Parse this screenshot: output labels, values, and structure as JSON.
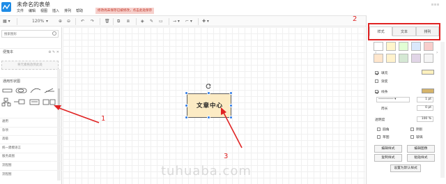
{
  "window": {
    "title": "未命名的表单",
    "menu": [
      "文件",
      "编辑",
      "视图",
      "插入",
      "排列",
      "帮助"
    ],
    "save_warning": "修改尚未保存已被修改，点击此处保存"
  },
  "toolbar": {
    "zoom": "120%"
  },
  "left_panel": {
    "search_placeholder": "搜索图形",
    "scratchpad_title": "便笺本",
    "scratchpad_drop": "将元素拖放到此处",
    "general_title": "通用形状图",
    "libraries": [
      "通用",
      "杂项",
      "高级",
      "统一建模语言",
      "服务类图",
      "流程图",
      "流程图"
    ]
  },
  "canvas": {
    "shape_text": "文章中心",
    "shape_fill": "#fcebc4"
  },
  "right_panel": {
    "tabs": [
      "样式",
      "文本",
      "排列"
    ],
    "active_tab": 0,
    "swatch_colors": [
      "#ffffff",
      "#fff6cc",
      "#e1ffd4",
      "#dae8fc",
      "#f8cecc",
      "#ffe6cc",
      "#fff2cc",
      "#d5e8d4",
      "#e1d5e7",
      "#f5f5f5"
    ],
    "fill_label": "填充",
    "gradient_label": "渐变",
    "line_label": "线条",
    "line_width": "1 pt",
    "perimeter_label": "周长",
    "perimeter_value": "0 pt",
    "opacity_label": "透明度",
    "opacity_value": "100 %",
    "checkbox_rounded": "圆角",
    "checkbox_shadow": "阴影",
    "checkbox_sketch": "草图",
    "checkbox_glass": "玻璃",
    "buttons": [
      "编辑样式",
      "编辑图像",
      "复制样式",
      "粘贴样式",
      "设置为默认样式"
    ],
    "fill_color": "#fdf0bd",
    "line_color": "#d6b46a"
  },
  "annotations": {
    "labels": [
      "1",
      "2",
      "3"
    ],
    "color": "#e02323"
  },
  "watermark": "tuhuaba.com"
}
